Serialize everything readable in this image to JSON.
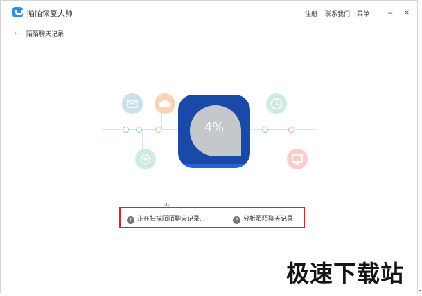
{
  "app": {
    "title": "陌陌恢复大师"
  },
  "menu": {
    "register": "注册",
    "contact": "联系我们",
    "more": "菜单"
  },
  "window_controls": {
    "minimize": "–",
    "close": "×"
  },
  "subheader": {
    "back": "←",
    "title": "陌陌聊天记录"
  },
  "scan": {
    "percent": "4%"
  },
  "steps": [
    {
      "num": "1",
      "label": "正在扫描陌陌聊天记录..."
    },
    {
      "num": "2",
      "label": "分析陌陌聊天记录"
    }
  ],
  "watermark": "极速下载站",
  "icons": [
    "mail-icon",
    "cloud-icon",
    "gear-icon",
    "clock-icon",
    "monitor-icon"
  ],
  "colors": {
    "accent": "#2f8fe8",
    "tile": "#1a4aa8",
    "highlight_border": "#d0282e"
  }
}
